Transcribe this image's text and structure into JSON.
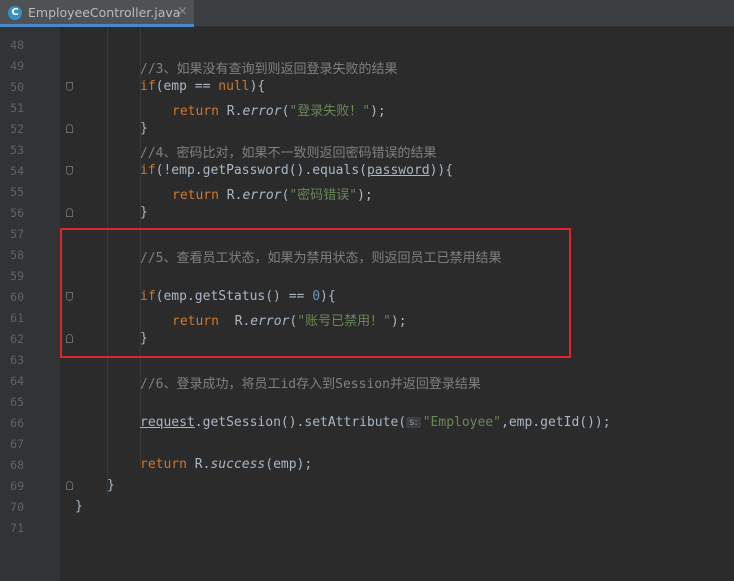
{
  "tab": {
    "icon_letter": "C",
    "label": "EmployeeController.java",
    "close": "×"
  },
  "lines": [
    {
      "num": "48",
      "fold": "",
      "indent": 0,
      "tokens": []
    },
    {
      "num": "49",
      "fold": "",
      "indent": 140,
      "tokens": [
        {
          "t": "//3、如果没有查询到则返回登录失败的结果",
          "c": "cm"
        }
      ]
    },
    {
      "num": "50",
      "fold": "open",
      "indent": 140,
      "tokens": [
        {
          "t": "if",
          "c": "kw"
        },
        {
          "t": "(emp == ",
          "c": ""
        },
        {
          "t": "null",
          "c": "kw"
        },
        {
          "t": "){",
          "c": ""
        }
      ]
    },
    {
      "num": "51",
      "fold": "",
      "indent": 172,
      "tokens": [
        {
          "t": "return ",
          "c": "kw"
        },
        {
          "t": "R.",
          "c": ""
        },
        {
          "t": "error",
          "c": "it"
        },
        {
          "t": "(",
          "c": ""
        },
        {
          "t": "\"登录失败！\"",
          "c": "str"
        },
        {
          "t": ");",
          "c": ""
        }
      ]
    },
    {
      "num": "52",
      "fold": "close",
      "indent": 140,
      "tokens": [
        {
          "t": "}",
          "c": ""
        }
      ]
    },
    {
      "num": "53",
      "fold": "",
      "indent": 140,
      "tokens": [
        {
          "t": "//4、密码比对，如果不一致则返回密码错误的结果",
          "c": "cm"
        }
      ]
    },
    {
      "num": "54",
      "fold": "open",
      "indent": 140,
      "tokens": [
        {
          "t": "if",
          "c": "kw"
        },
        {
          "t": "(!emp.getPassword().equals(",
          "c": ""
        },
        {
          "t": "password",
          "c": "var"
        },
        {
          "t": ")){",
          "c": ""
        }
      ]
    },
    {
      "num": "55",
      "fold": "",
      "indent": 172,
      "tokens": [
        {
          "t": "return ",
          "c": "kw"
        },
        {
          "t": "R.",
          "c": ""
        },
        {
          "t": "error",
          "c": "it"
        },
        {
          "t": "(",
          "c": ""
        },
        {
          "t": "\"密码错误\"",
          "c": "str"
        },
        {
          "t": ");",
          "c": ""
        }
      ]
    },
    {
      "num": "56",
      "fold": "close",
      "indent": 140,
      "tokens": [
        {
          "t": "}",
          "c": ""
        }
      ]
    },
    {
      "num": "57",
      "fold": "",
      "indent": 0,
      "tokens": []
    },
    {
      "num": "58",
      "fold": "",
      "indent": 140,
      "tokens": [
        {
          "t": "//5、查看员工状态，如果为禁用状态，则返回员工已禁用结果",
          "c": "cm"
        }
      ]
    },
    {
      "num": "59",
      "fold": "",
      "indent": 0,
      "tokens": []
    },
    {
      "num": "60",
      "fold": "open",
      "indent": 140,
      "tokens": [
        {
          "t": "if",
          "c": "kw"
        },
        {
          "t": "(emp.getStatus() == ",
          "c": ""
        },
        {
          "t": "0",
          "c": "num"
        },
        {
          "t": "){",
          "c": ""
        }
      ]
    },
    {
      "num": "61",
      "fold": "",
      "indent": 172,
      "tokens": [
        {
          "t": "return  ",
          "c": "kw"
        },
        {
          "t": "R.",
          "c": ""
        },
        {
          "t": "error",
          "c": "it"
        },
        {
          "t": "(",
          "c": ""
        },
        {
          "t": "\"账号已禁用！\"",
          "c": "str"
        },
        {
          "t": ");",
          "c": ""
        }
      ]
    },
    {
      "num": "62",
      "fold": "close",
      "indent": 140,
      "tokens": [
        {
          "t": "}",
          "c": ""
        }
      ]
    },
    {
      "num": "63",
      "fold": "",
      "indent": 0,
      "tokens": []
    },
    {
      "num": "64",
      "fold": "",
      "indent": 140,
      "tokens": [
        {
          "t": "//6、登录成功，将员工id存入到Session并返回登录结果",
          "c": "cm"
        }
      ]
    },
    {
      "num": "65",
      "fold": "",
      "indent": 0,
      "tokens": []
    },
    {
      "num": "66",
      "fold": "",
      "indent": 140,
      "tokens": [
        {
          "t": "request",
          "c": "var"
        },
        {
          "t": ".getSession().setAttribute(",
          "c": ""
        },
        {
          "t": "s:",
          "c": "hint"
        },
        {
          "t": "\"Employee\"",
          "c": "str"
        },
        {
          "t": ",emp.getId());",
          "c": ""
        }
      ]
    },
    {
      "num": "67",
      "fold": "",
      "indent": 0,
      "tokens": []
    },
    {
      "num": "68",
      "fold": "",
      "indent": 140,
      "tokens": [
        {
          "t": "return ",
          "c": "kw"
        },
        {
          "t": "R.",
          "c": ""
        },
        {
          "t": "success",
          "c": "it"
        },
        {
          "t": "(emp);",
          "c": ""
        }
      ]
    },
    {
      "num": "69",
      "fold": "close",
      "indent": 107,
      "tokens": [
        {
          "t": "}",
          "c": ""
        }
      ]
    },
    {
      "num": "70",
      "fold": "",
      "indent": 75,
      "tokens": [
        {
          "t": "}",
          "c": ""
        }
      ]
    },
    {
      "num": "71",
      "fold": "",
      "indent": 0,
      "tokens": []
    }
  ],
  "colors": {
    "highlight_box": "#e0252e",
    "keyword": "#cc7832",
    "string": "#6a8759",
    "comment": "#808080",
    "number": "#6897bb"
  }
}
